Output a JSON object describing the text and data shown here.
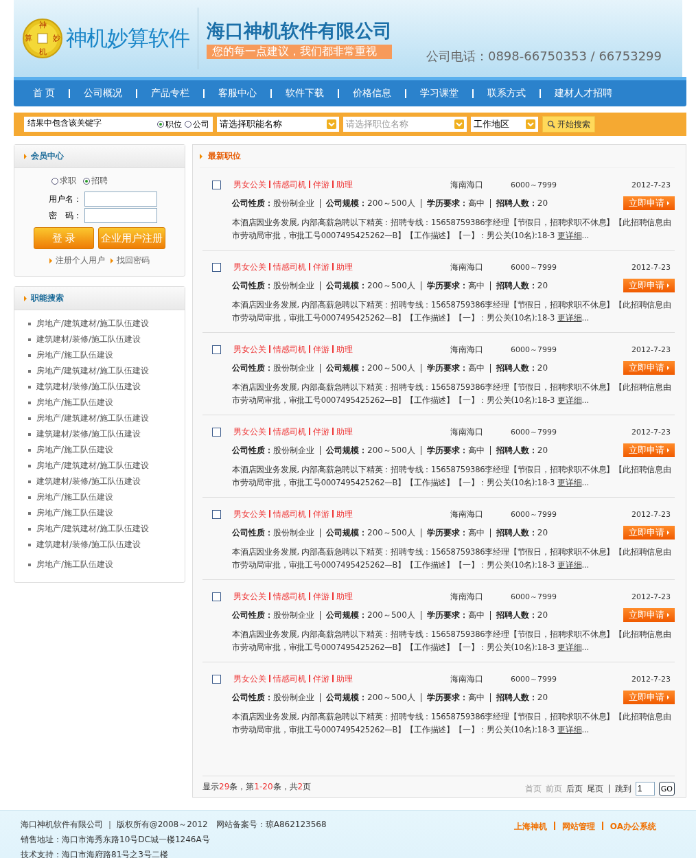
{
  "header": {
    "coin_chars": [
      "神",
      "妙",
      "机",
      "算"
    ],
    "brand": "神机妙算软件",
    "company": "海口神机软件有限公司",
    "slogan": "您的每一点建议，我们都非常重视",
    "phone": "公司电话：0898-66750353 / 66753299"
  },
  "nav": [
    "首 页",
    "公司概况",
    "产品专栏",
    "客服中心",
    "软件下载",
    "价格信息",
    "学习课堂",
    "联系方式",
    "建材人才招聘"
  ],
  "search": {
    "keyword": "结果中包含该关键字",
    "radios": [
      {
        "label": "职位",
        "selected": true
      },
      {
        "label": "公司",
        "selected": false
      }
    ],
    "selects": [
      {
        "value": "请选择职能名称"
      },
      {
        "placeholder": "请选择职位名称"
      },
      {
        "value": "工作地区"
      }
    ],
    "button": "开始搜索"
  },
  "member": {
    "title": "会员中心",
    "roles": [
      {
        "label": "求职",
        "selected": false
      },
      {
        "label": "招聘",
        "selected": true
      }
    ],
    "username_label": "用户名：",
    "password_label": "密　码：",
    "login": "登 录",
    "register_company": "企业用户注册",
    "links": [
      "注册个人用户",
      "找回密码"
    ]
  },
  "categories": {
    "title": "职能搜索",
    "items": [
      "房地产/建筑建材/施工队伍建设",
      "建筑建材/装修/施工队伍建设",
      "房地产/施工队伍建设",
      "房地产/建筑建材/施工队伍建设",
      "建筑建材/装修/施工队伍建设",
      "房地产/施工队伍建设",
      "房地产/建筑建材/施工队伍建设",
      "建筑建材/装修/施工队伍建设",
      "房地产/施工队伍建设",
      "房地产/建筑建材/施工队伍建设",
      "建筑建材/装修/施工队伍建设",
      "房地产/施工队伍建设",
      "房地产/施工队伍建设",
      "房地产/建筑建材/施工队伍建设",
      "建筑建材/装修/施工队伍建设",
      "房地产/施工队伍建设"
    ]
  },
  "jobs": {
    "title": "最新职位",
    "items": [
      {
        "checked": false,
        "title_parts": [
          "男女公关",
          "情感司机",
          "伴游",
          "助理"
        ],
        "location": "海南海口",
        "salary": "6000～7999",
        "date": "2012-7-23",
        "fields": [
          {
            "label": "公司性质：",
            "value": "股份制企业"
          },
          {
            "label": "公司规模：",
            "value": "200～500人"
          },
          {
            "label": "学历要求：",
            "value": "高中"
          },
          {
            "label": "招聘人数：",
            "value": "20"
          }
        ],
        "apply": "立即申请",
        "description": "本酒店因业务发展, 内部高薪急聘以下精英：招聘专线：15658759386李经理【节假日，招聘求职不休息】【此招聘信息由市劳动局审批，审批工号0007495425262—B】【工作描述】【一】：男公关(10名):18-3",
        "more": "更详细",
        "ellipsis": "..."
      },
      {
        "checked": false,
        "title_parts": [
          "男女公关",
          "情感司机",
          "伴游",
          "助理"
        ],
        "location": "海南海口",
        "salary": "6000～7999",
        "date": "2012-7-23",
        "fields": [
          {
            "label": "公司性质：",
            "value": "股份制企业"
          },
          {
            "label": "公司规模：",
            "value": "200～500人"
          },
          {
            "label": "学历要求：",
            "value": "高中"
          },
          {
            "label": "招聘人数：",
            "value": "20"
          }
        ],
        "apply": "立即申请",
        "description": "本酒店因业务发展, 内部高薪急聘以下精英：招聘专线：15658759386李经理【节假日，招聘求职不休息】【此招聘信息由市劳动局审批，审批工号0007495425262—B】【工作描述】【一】：男公关(10名):18-3",
        "more": "更详细",
        "ellipsis": "..."
      },
      {
        "checked": false,
        "title_parts": [
          "男女公关",
          "情感司机",
          "伴游",
          "助理"
        ],
        "location": "海南海口",
        "salary": "6000～7999",
        "date": "2012-7-23",
        "fields": [
          {
            "label": "公司性质：",
            "value": "股份制企业"
          },
          {
            "label": "公司规模：",
            "value": "200～500人"
          },
          {
            "label": "学历要求：",
            "value": "高中"
          },
          {
            "label": "招聘人数：",
            "value": "20"
          }
        ],
        "apply": "立即申请",
        "description": "本酒店因业务发展, 内部高薪急聘以下精英：招聘专线：15658759386李经理【节假日，招聘求职不休息】【此招聘信息由市劳动局审批，审批工号0007495425262—B】【工作描述】【一】：男公关(10名):18-3",
        "more": "更详细",
        "ellipsis": "..."
      },
      {
        "checked": false,
        "title_parts": [
          "男女公关",
          "情感司机",
          "伴游",
          "助理"
        ],
        "location": "海南海口",
        "salary": "6000～7999",
        "date": "2012-7-23",
        "fields": [
          {
            "label": "公司性质：",
            "value": "股份制企业"
          },
          {
            "label": "公司规模：",
            "value": "200～500人"
          },
          {
            "label": "学历要求：",
            "value": "高中"
          },
          {
            "label": "招聘人数：",
            "value": "20"
          }
        ],
        "apply": "立即申请",
        "description": "本酒店因业务发展, 内部高薪急聘以下精英：招聘专线：15658759386李经理【节假日，招聘求职不休息】【此招聘信息由市劳动局审批，审批工号0007495425262—B】【工作描述】【一】：男公关(10名):18-3",
        "more": "更详细",
        "ellipsis": "..."
      },
      {
        "checked": false,
        "title_parts": [
          "男女公关",
          "情感司机",
          "伴游",
          "助理"
        ],
        "location": "海南海口",
        "salary": "6000～7999",
        "date": "2012-7-23",
        "fields": [
          {
            "label": "公司性质：",
            "value": "股份制企业"
          },
          {
            "label": "公司规模：",
            "value": "200～500人"
          },
          {
            "label": "学历要求：",
            "value": "高中"
          },
          {
            "label": "招聘人数：",
            "value": "20"
          }
        ],
        "apply": "立即申请",
        "description": "本酒店因业务发展, 内部高薪急聘以下精英：招聘专线：15658759386李经理【节假日，招聘求职不休息】【此招聘信息由市劳动局审批，审批工号0007495425262—B】【工作描述】【一】：男公关(10名):18-3",
        "more": "更详细",
        "ellipsis": "..."
      },
      {
        "checked": false,
        "title_parts": [
          "男女公关",
          "情感司机",
          "伴游",
          "助理"
        ],
        "location": "海南海口",
        "salary": "6000～7999",
        "date": "2012-7-23",
        "fields": [
          {
            "label": "公司性质：",
            "value": "股份制企业"
          },
          {
            "label": "公司规模：",
            "value": "200～500人"
          },
          {
            "label": "学历要求：",
            "value": "高中"
          },
          {
            "label": "招聘人数：",
            "value": "20"
          }
        ],
        "apply": "立即申请",
        "description": "本酒店因业务发展, 内部高薪急聘以下精英：招聘专线：15658759386李经理【节假日，招聘求职不休息】【此招聘信息由市劳动局审批，审批工号0007495425262—B】【工作描述】【一】：男公关(10名):18-3",
        "more": "更详细",
        "ellipsis": "..."
      },
      {
        "checked": false,
        "title_parts": [
          "男女公关",
          "情感司机",
          "伴游",
          "助理"
        ],
        "location": "海南海口",
        "salary": "6000～7999",
        "date": "2012-7-23",
        "fields": [
          {
            "label": "公司性质：",
            "value": "股份制企业"
          },
          {
            "label": "公司规模：",
            "value": "200～500人"
          },
          {
            "label": "学历要求：",
            "value": "高中"
          },
          {
            "label": "招聘人数：",
            "value": "20"
          }
        ],
        "apply": "立即申请",
        "description": "本酒店因业务发展, 内部高薪急聘以下精英：招聘专线：15658759386李经理【节假日，招聘求职不休息】【此招聘信息由市劳动局审批，审批工号0007495425262—B】【工作描述】【一】：男公关(10名):18-3",
        "more": "更详细",
        "ellipsis": "..."
      }
    ]
  },
  "pager": {
    "summary": [
      {
        "text": "显示",
        "highlight": false
      },
      {
        "text": "29",
        "highlight": true
      },
      {
        "text": "条，第",
        "highlight": false
      },
      {
        "text": "1-20",
        "highlight": true
      },
      {
        "text": "条，共",
        "highlight": false
      },
      {
        "text": "2",
        "highlight": true
      },
      {
        "text": "页",
        "highlight": false
      }
    ],
    "links": [
      {
        "label": "首页",
        "disabled": true
      },
      {
        "label": "前页",
        "disabled": true
      },
      {
        "label": "后页",
        "disabled": false
      },
      {
        "label": "尾页",
        "disabled": false
      }
    ],
    "jump_label": "跳到",
    "page": "1",
    "go": "GO"
  },
  "footer": {
    "lines": [
      "海口神机软件有限公司 ｜ 版权所有@2008～2012　网站备案号：琼A862123568",
      "销售地址：海口市海秀东路10号DC城一楼1246A号",
      "技术支持：海口市海府路81号之3号二楼"
    ],
    "links": [
      "上海神机",
      "网站管理",
      "OA办公系统"
    ]
  }
}
